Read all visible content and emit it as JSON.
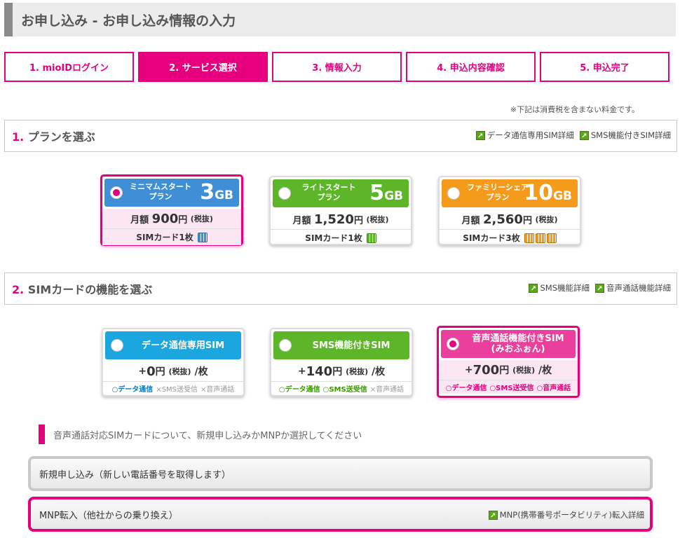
{
  "page": {
    "title": "お申し込み - お申し込み情報の入力"
  },
  "steps": [
    {
      "label": "1. mioIDログイン",
      "active": false
    },
    {
      "label": "2. サービス選択",
      "active": true
    },
    {
      "label": "3. 情報入力",
      "active": false
    },
    {
      "label": "4. 申込内容確認",
      "active": false
    },
    {
      "label": "5. 申込完了",
      "active": false
    }
  ],
  "tax_note": "※下記は消費税を含まない料金です。",
  "plan_section": {
    "number": "1.",
    "title": "プランを選ぶ",
    "links": [
      "データ通信専用SIM詳細",
      "SMS機能付きSIM詳細"
    ]
  },
  "plans": [
    {
      "name_line1": "ミニマムスタート",
      "name_line2": "プラン",
      "size_num": "3",
      "size_unit": "GB",
      "price_prefix": "月額",
      "price_num": "900",
      "price_unit": "円",
      "price_tax": "(税抜)",
      "sim_label": "SIMカード1枚",
      "sim_count": 1,
      "color": "#3f8fd6",
      "selected": true
    },
    {
      "name_line1": "ライトスタート",
      "name_line2": "プラン",
      "size_num": "5",
      "size_unit": "GB",
      "price_prefix": "月額",
      "price_num": "1,520",
      "price_unit": "円",
      "price_tax": "(税抜)",
      "sim_label": "SIMカード1枚",
      "sim_count": 1,
      "color": "#5db528",
      "selected": false
    },
    {
      "name_line1": "ファミリーシェア",
      "name_line2": "プラン",
      "size_num": "10",
      "size_unit": "GB",
      "price_prefix": "月額",
      "price_num": "2,560",
      "price_unit": "円",
      "price_tax": "(税抜)",
      "sim_label": "SIMカード3枚",
      "sim_count": 3,
      "color": "#f49b1c",
      "selected": false
    }
  ],
  "sim_section": {
    "number": "2.",
    "title": "SIMカードの機能を選ぶ",
    "links": [
      "SMS機能詳細",
      "音声通話機能詳細"
    ]
  },
  "sim_types": [
    {
      "name_line1": "データ通信専用SIM",
      "name_line2": "",
      "price_prefix": "+",
      "price_num": "0",
      "price_unit": "円",
      "price_tax": "(税抜)",
      "price_suffix": "/枚",
      "features": [
        {
          "label": "○データ通信",
          "on": true
        },
        {
          "label": "×SMS送受信",
          "on": false
        },
        {
          "label": "×音声通話",
          "on": false
        }
      ],
      "color": "#1ba6e0",
      "feature_class": "f-on-blue",
      "selected": false
    },
    {
      "name_line1": "SMS機能付きSIM",
      "name_line2": "",
      "price_prefix": "+",
      "price_num": "140",
      "price_unit": "円",
      "price_tax": "(税抜)",
      "price_suffix": "/枚",
      "features": [
        {
          "label": "○データ通信",
          "on": true
        },
        {
          "label": "○SMS送受信",
          "on": true
        },
        {
          "label": "×音声通話",
          "on": false
        }
      ],
      "color": "#5db528",
      "feature_class": "f-on-green",
      "selected": false
    },
    {
      "name_line1": "音声通話機能付きSIM",
      "name_line2": "(みおふぉん)",
      "price_prefix": "+",
      "price_num": "700",
      "price_unit": "円",
      "price_tax": "(税抜)",
      "price_suffix": "/枚",
      "features": [
        {
          "label": "○データ通信",
          "on": true
        },
        {
          "label": "○SMS送受信",
          "on": true
        },
        {
          "label": "○音声通話",
          "on": true
        }
      ],
      "color": "#ea3f9c",
      "feature_class": "f-on-pink",
      "selected": true
    }
  ],
  "notice": "音声通話対応SIMカードについて、新規申し込みかMNPか選択してください",
  "options": [
    {
      "label": "新規申し込み（新しい電話番号を取得します）",
      "selected": false,
      "link": ""
    },
    {
      "label": "MNP転入（他社からの乗り換え）",
      "selected": true,
      "link": "MNP(携帯番号ポータビリティ)転入詳細"
    }
  ],
  "colors": {
    "accent": "#e6007e",
    "link_arrow": "#5ea619"
  }
}
